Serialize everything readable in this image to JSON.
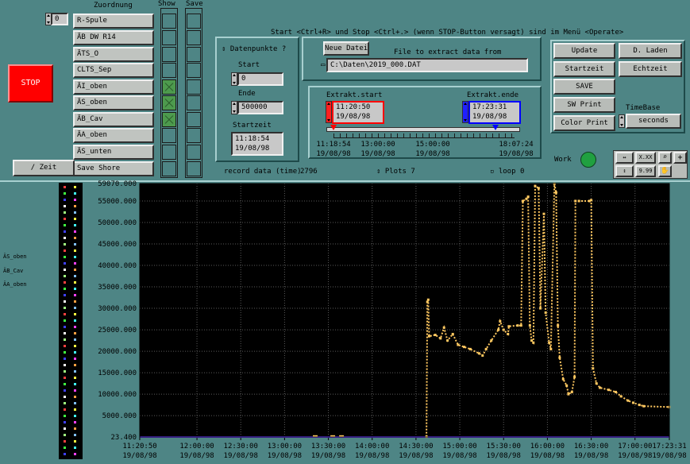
{
  "header": {
    "zuordnung": "Zuordnung",
    "show": "Show",
    "save": "Save",
    "instructions": "Start <Ctrl+R> und Stop <Ctrl+.> (wenn STOP-Button versagt) sind im Menü <Operate>"
  },
  "stop_button": "STOP",
  "channel_index": "0",
  "zuordnung_items": [
    "R-Spule",
    "ÄB DW R14",
    "ÄTS_O",
    "CLTS_Sep",
    "ÄI_oben",
    "ÄS_oben",
    "ÄB_Cav",
    "ÄA_oben",
    "ÄS_unten",
    "Save Shore"
  ],
  "show_states": [
    false,
    false,
    false,
    false,
    true,
    true,
    true,
    false,
    false,
    false
  ],
  "zeit_button": "/ Zeit",
  "datenpunkte": {
    "title": "Datenpunkte ?",
    "start_label": "Start",
    "start_value": "0",
    "ende_label": "Ende",
    "ende_value": "500000",
    "startzeit_label": "Startzeit",
    "startzeit_time": "11:18:54",
    "startzeit_date": "19/08/98"
  },
  "file": {
    "new_button": "Neue Datei",
    "label": "File to extract data from",
    "path": "C:\\Daten\\2019_000.DAT"
  },
  "extract": {
    "start_label": "Extrakt.start",
    "start_time": "11:20:50",
    "start_date": "19/08/98",
    "end_label": "Extrakt.ende",
    "end_time": "17:23:31",
    "end_date": "19/08/98",
    "scale_times": [
      "11:18:54",
      "13:00:00",
      "15:00:00",
      "18:07:24"
    ],
    "scale_dates": [
      "19/08/98",
      "19/08/98",
      "19/08/98",
      "19/08/98"
    ]
  },
  "buttons": {
    "update": "Update",
    "d_laden": "D. Laden",
    "startzeit": "Startzeit",
    "echtzeit": "Echtzeit",
    "save": "SAVE",
    "sw_print": "SW Print",
    "color_print": "Color Print",
    "timebase_label": "TimeBase",
    "timebase_value": "seconds"
  },
  "status": {
    "record_label": "record data (time)",
    "record_value": "2796",
    "plots_label": "Plots",
    "plots_value": "7",
    "loop_label": "loop",
    "loop_value": "0",
    "work_label": "Work"
  },
  "palette": {
    "x_fmt": "X.XX",
    "y_fmt": "9.99"
  },
  "legend": [
    "ÄS_oben",
    "ÄB_Cav",
    "ÄA_oben"
  ],
  "colors": {
    "background": "#4e8585",
    "plot_bg": "#000000",
    "grid": "#5a5a5a",
    "series": "#ffc860",
    "baseline": "#6a3cff",
    "stop": "#ff0000",
    "led": "#20a040"
  },
  "chart_data": {
    "type": "line",
    "ylim": [
      23.4,
      59070
    ],
    "y_ticks": [
      "59070.000",
      "55000.000",
      "50000.000",
      "45000.000",
      "40000.000",
      "35000.000",
      "30000.000",
      "25000.000",
      "20000.000",
      "15000.000",
      "10000.000",
      "5000.000",
      "23.400"
    ],
    "y_tick_values": [
      59070,
      55000,
      50000,
      45000,
      40000,
      35000,
      30000,
      25000,
      20000,
      15000,
      10000,
      5000,
      23.4
    ],
    "x_ticks": [
      {
        "time": "11:20:50",
        "date": "19/08/98",
        "hour": 11.347
      },
      {
        "time": "12:00:00",
        "date": "19/08/98",
        "hour": 12.0
      },
      {
        "time": "12:30:00",
        "date": "19/08/98",
        "hour": 12.5
      },
      {
        "time": "13:00:00",
        "date": "19/08/98",
        "hour": 13.0
      },
      {
        "time": "13:30:00",
        "date": "19/08/98",
        "hour": 13.5
      },
      {
        "time": "14:00:00",
        "date": "19/08/98",
        "hour": 14.0
      },
      {
        "time": "14:30:00",
        "date": "19/08/98",
        "hour": 14.5
      },
      {
        "time": "15:00:00",
        "date": "19/08/98",
        "hour": 15.0
      },
      {
        "time": "15:30:00",
        "date": "19/08/98",
        "hour": 15.5
      },
      {
        "time": "16:00:00",
        "date": "19/08/98",
        "hour": 16.0
      },
      {
        "time": "16:30:00",
        "date": "19/08/98",
        "hour": 16.5
      },
      {
        "time": "17:00:00",
        "date": "19/08/98",
        "hour": 17.0
      },
      {
        "time": "17:23:31",
        "date": "19/08/98",
        "hour": 17.392
      }
    ],
    "xlim_hours": [
      11.347,
      17.392
    ],
    "series": [
      {
        "values": [
          [
            14.62,
            100
          ],
          [
            14.63,
            31500
          ],
          [
            14.64,
            32000
          ],
          [
            14.65,
            23500
          ],
          [
            14.72,
            23800
          ],
          [
            14.78,
            23000
          ],
          [
            14.82,
            25500
          ],
          [
            14.86,
            22500
          ],
          [
            14.92,
            24000
          ],
          [
            14.98,
            21500
          ],
          [
            15.05,
            21000
          ],
          [
            15.12,
            20500
          ],
          [
            15.22,
            19500
          ],
          [
            15.26,
            19000
          ],
          [
            15.3,
            20500
          ],
          [
            15.36,
            22500
          ],
          [
            15.44,
            25000
          ],
          [
            15.46,
            27000
          ],
          [
            15.5,
            25000
          ],
          [
            15.55,
            24000
          ],
          [
            15.56,
            25800
          ],
          [
            15.66,
            26000
          ],
          [
            15.7,
            26000
          ],
          [
            15.72,
            55000
          ],
          [
            15.76,
            55500
          ],
          [
            15.78,
            56000
          ],
          [
            15.8,
            26000
          ],
          [
            15.82,
            22500
          ],
          [
            15.84,
            22000
          ],
          [
            15.86,
            58500
          ],
          [
            15.9,
            58000
          ],
          [
            15.92,
            30000
          ],
          [
            15.96,
            52000
          ],
          [
            15.98,
            29000
          ],
          [
            16.02,
            22000
          ],
          [
            16.04,
            20500
          ],
          [
            16.08,
            59000
          ],
          [
            16.1,
            57000
          ],
          [
            16.12,
            26000
          ],
          [
            16.14,
            18500
          ],
          [
            16.18,
            13500
          ],
          [
            16.22,
            12000
          ],
          [
            16.24,
            10000
          ],
          [
            16.28,
            10500
          ],
          [
            16.31,
            14000
          ],
          [
            16.32,
            55000
          ],
          [
            16.36,
            55000
          ],
          [
            16.48,
            55000
          ],
          [
            16.5,
            55200
          ],
          [
            16.52,
            16000
          ],
          [
            16.56,
            12500
          ],
          [
            16.6,
            11500
          ],
          [
            16.7,
            11000
          ],
          [
            16.78,
            10500
          ],
          [
            16.84,
            9500
          ],
          [
            16.92,
            8500
          ],
          [
            16.98,
            8000
          ],
          [
            17.05,
            7500
          ],
          [
            17.1,
            7200
          ],
          [
            17.39,
            7000
          ]
        ]
      },
      {
        "values": [
          [
            11.35,
            23.4
          ],
          [
            14.62,
            23.4
          ],
          [
            17.39,
            23.4
          ]
        ]
      }
    ]
  }
}
